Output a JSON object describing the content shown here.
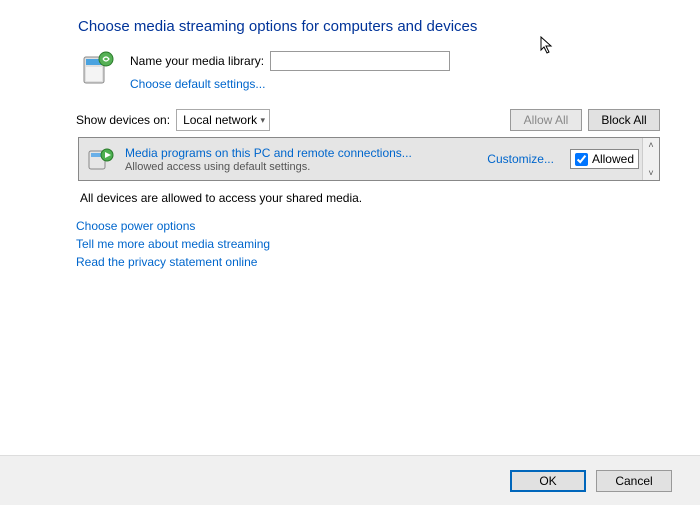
{
  "title": "Choose media streaming options for computers and devices",
  "library": {
    "name_label": "Name your media library:",
    "name_value": "",
    "default_link": "Choose default settings..."
  },
  "filter": {
    "label": "Show devices on:",
    "selected": "Local network"
  },
  "bulk": {
    "allow_all": "Allow All",
    "block_all": "Block All"
  },
  "device": {
    "title": "Media programs on this PC and remote connections...",
    "sub": "Allowed access using default settings.",
    "customize": "Customize...",
    "allowed_label": "Allowed",
    "allowed_checked": true
  },
  "status": "All devices are allowed to access your shared media.",
  "links": {
    "power": "Choose power options",
    "more": "Tell me more about media streaming",
    "privacy": "Read the privacy statement online"
  },
  "footer": {
    "ok": "OK",
    "cancel": "Cancel"
  }
}
